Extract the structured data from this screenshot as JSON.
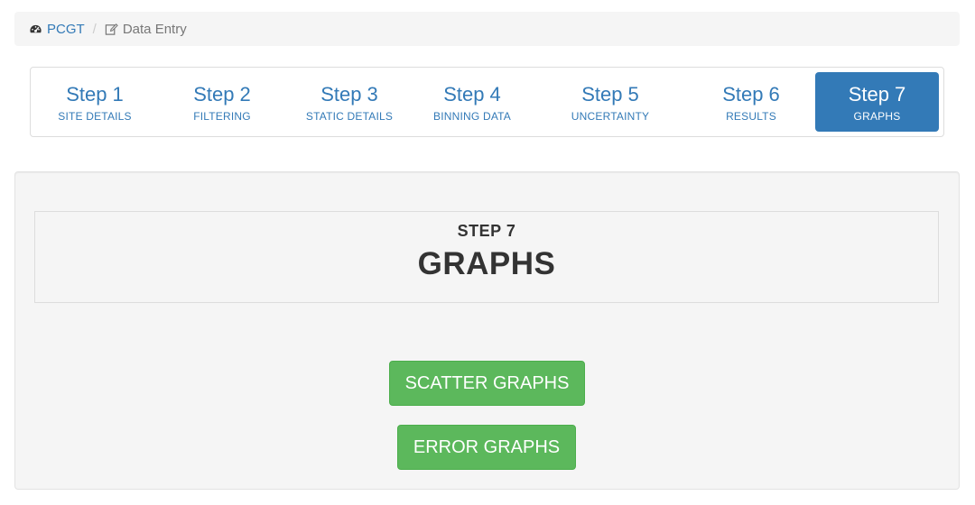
{
  "breadcrumb": {
    "home_label": "PCGT",
    "home_icon": "dashboard-icon",
    "current_label": "Data Entry",
    "current_icon": "edit-icon",
    "separator": "/"
  },
  "steps": [
    {
      "title": "Step 1",
      "subtitle": "SITE DETAILS",
      "active": false
    },
    {
      "title": "Step 2",
      "subtitle": "FILTERING",
      "active": false
    },
    {
      "title": "Step 3",
      "subtitle": "STATIC DETAILS",
      "active": false
    },
    {
      "title": "Step 4",
      "subtitle": "BINNING DATA",
      "active": false
    },
    {
      "title": "Step 5",
      "subtitle": "UNCERTAINTY",
      "active": false
    },
    {
      "title": "Step 6",
      "subtitle": "RESULTS",
      "active": false
    },
    {
      "title": "Step 7",
      "subtitle": "GRAPHS",
      "active": true
    }
  ],
  "main": {
    "step_label": "STEP 7",
    "title": "GRAPHS",
    "buttons": {
      "scatter": "SCATTER GRAPHS",
      "error": "ERROR GRAPHS"
    }
  },
  "colors": {
    "primary": "#337ab7",
    "success": "#5cb85c",
    "panel_bg": "#f5f5f5"
  }
}
